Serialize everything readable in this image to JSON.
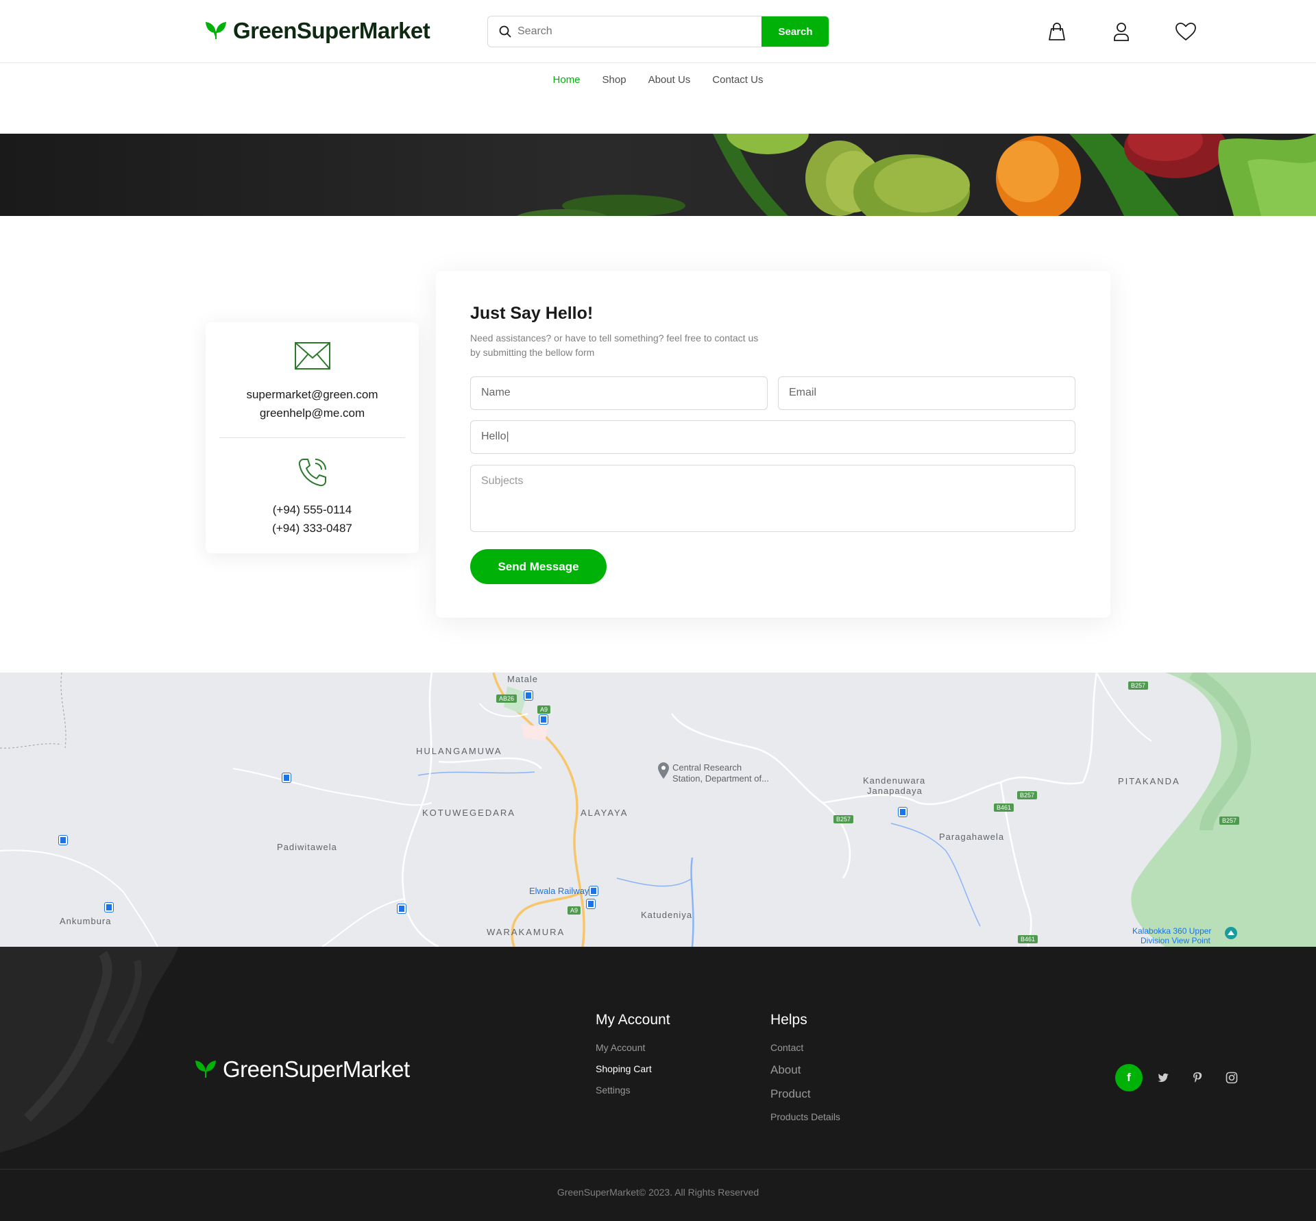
{
  "brand": {
    "name": "GreenSuperMarket",
    "accent": "#00b207"
  },
  "header": {
    "search_placeholder": "Search",
    "search_button": "Search",
    "icons": [
      "shopping-bag-icon",
      "user-icon",
      "heart-icon"
    ]
  },
  "nav": {
    "items": [
      {
        "label": "Home",
        "active": true
      },
      {
        "label": "Shop",
        "active": false
      },
      {
        "label": "About Us",
        "active": false
      },
      {
        "label": "Contact Us",
        "active": false
      }
    ]
  },
  "contact_info": {
    "emails": [
      "supermarket@green.com",
      "greenhelp@me.com"
    ],
    "phones": [
      "(+94) 555-0114",
      "(+94) 333-0487"
    ]
  },
  "form": {
    "title": "Just Say Hello!",
    "description_line1": "Need assistances? or have to tell something? feel free to contact us",
    "description_line2": "by submitting the bellow form",
    "name_placeholder": "Name",
    "email_placeholder": "Email",
    "hello_value": "Hello|",
    "subjects_placeholder": "Subjects",
    "send_button": "Send Message"
  },
  "map": {
    "labels": {
      "matale": "Matale",
      "hulangamuwa": "HULANGAMUWA",
      "kotuwegedara": "KOTUWEGEDARA",
      "alayaya": "ALAYAYA",
      "padiwitawela": "Padiwitawela",
      "ankumbura": "Ankumbura",
      "warakamura": "WARAKAMURA",
      "katudeniya": "Katudeniya",
      "central_research_1": "Central Research",
      "central_research_2": "Station, Department of...",
      "kandenuwara_1": "Kandenuwara",
      "kandenuwara_2": "Janapadaya",
      "paragahawela": "Paragahawela",
      "pitakanda": "PITAKANDA",
      "elwala": "Elwala Railway",
      "kalabokka_1": "Kalabokka 360 Upper",
      "kalabokka_2": "Division View Point"
    },
    "badges": {
      "ab26": "AB26",
      "a9_top": "A9",
      "a9_bottom": "A9",
      "b257_1": "B257",
      "b257_2": "B257",
      "b257_3": "B257",
      "b257_4": "B257",
      "b461_1": "B461",
      "b461_2": "B461"
    }
  },
  "footer": {
    "my_account": {
      "heading": "My Account",
      "links": [
        "My Account",
        "Shoping Cart",
        "Settings"
      ]
    },
    "helps": {
      "heading": "Helps",
      "links": [
        "Contact",
        "About",
        "Product",
        "Products Details"
      ]
    },
    "socials": {
      "facebook": "f",
      "twitter": "twitter-icon",
      "pinterest": "pinterest-icon",
      "instagram": "instagram-icon"
    },
    "copyright": "GreenSuperMarket© 2023. All Rights Reserved"
  }
}
